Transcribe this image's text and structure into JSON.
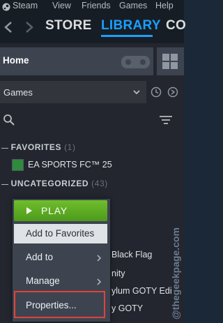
{
  "menubar": {
    "items": [
      "Steam",
      "View",
      "Friends",
      "Games",
      "Help"
    ]
  },
  "nav": {
    "store": "STORE",
    "library": "LIBRARY",
    "community": "CO"
  },
  "home": {
    "label": "Home"
  },
  "filter": {
    "selected": "Games"
  },
  "favorites": {
    "title": "FAVORITES",
    "count": "(1)",
    "games": [
      "EA SPORTS FC™ 25"
    ]
  },
  "uncategorized": {
    "title": "UNCATEGORIZED",
    "count": "(43)"
  },
  "background_games": [
    "Black Flag",
    "nity",
    "ylum GOTY Edi",
    "y GOTY"
  ],
  "context_menu": {
    "play": "PLAY",
    "add_to_favorites": "Add to Favorites",
    "add_to": "Add to",
    "manage": "Manage",
    "properties": "Properties..."
  },
  "watermark": "@thegeekpage.com",
  "colors": {
    "accent": "#1a9fff",
    "play_green": "#5ba32b",
    "highlight_box": "#e0433a"
  }
}
